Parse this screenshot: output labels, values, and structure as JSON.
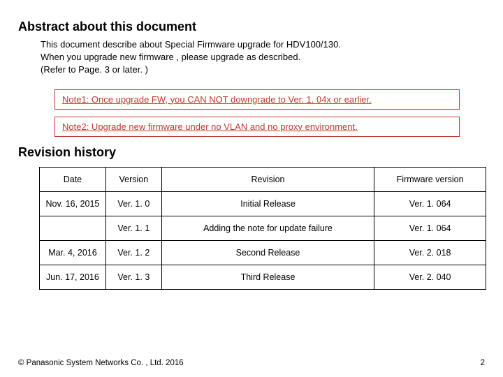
{
  "abstract": {
    "heading": "Abstract about this document",
    "line1": "This document describe about Special Firmware upgrade for HDV100/130.",
    "line2": "When you upgrade new firmware , please upgrade as described.",
    "line3": "(Refer to Page. 3 or later. )"
  },
  "notes": {
    "n1_label": "Note1:",
    "n1_text": " Once upgrade FW, you CAN NOT downgrade to Ver. 1. 04x or earlier.",
    "n2_label": "Note2:",
    "n2_text": " Upgrade new firmware under no VLAN and no proxy environment."
  },
  "revision": {
    "heading": "Revision history",
    "headers": {
      "date": "Date",
      "version": "Version",
      "revision": "Revision",
      "fw": "Firmware version"
    },
    "rows": [
      {
        "date": "Nov. 16, 2015",
        "version": "Ver. 1. 0",
        "revision": "Initial Release",
        "fw": "Ver. 1. 064"
      },
      {
        "date": "",
        "version": "Ver. 1. 1",
        "revision": "Adding the note for update failure",
        "fw": "Ver. 1. 064"
      },
      {
        "date": "Mar. 4, 2016",
        "version": "Ver. 1. 2",
        "revision": "Second Release",
        "fw": "Ver. 2. 018"
      },
      {
        "date": "Jun. 17, 2016",
        "version": "Ver. 1. 3",
        "revision": "Third Release",
        "fw": "Ver. 2. 040"
      }
    ]
  },
  "footer": {
    "copyright": "© Panasonic System Networks Co. , Ltd.  2016",
    "page": "2"
  }
}
